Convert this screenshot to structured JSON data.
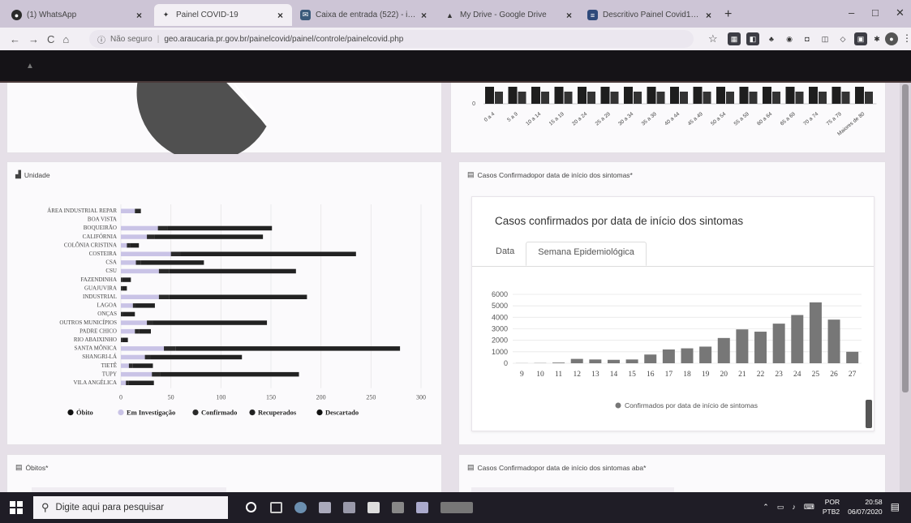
{
  "browser": {
    "tabs": [
      {
        "label": "(1) WhatsApp",
        "icon": "whatsapp-icon"
      },
      {
        "label": "Painel COVID-19",
        "icon": "covid-icon"
      },
      {
        "label": "Caixa de entrada (522) - isaager",
        "icon": "mail-icon"
      },
      {
        "label": "My Drive - Google Drive",
        "icon": "drive-icon"
      },
      {
        "label": "Descritivo Painel Covid19 - Goog",
        "icon": "docs-icon"
      }
    ],
    "new_tab": "+",
    "security": "Não seguro",
    "url": "geo.araucaria.pr.gov.br/painelcovid/painel/controle/painelcovid.php"
  },
  "age_chart": {
    "categories": [
      "0 a 4",
      "5 a 9",
      "10 a 14",
      "15 a 19",
      "20 a 24",
      "25 a 29",
      "30 a 34",
      "35 a 39",
      "40 a 44",
      "45 a 49",
      "50 a 54",
      "55 a 59",
      "60 a 64",
      "65 a 69",
      "70 a 74",
      "75 a 79",
      "Maiores de 80"
    ],
    "zero_label": "0"
  },
  "unidade_card": {
    "title": "Unidade",
    "chart_data": {
      "type": "bar",
      "orientation": "horizontal",
      "stacked": true,
      "categories": [
        "ÁREA INDUSTRIAL REPAR",
        "BOA VISTA",
        "BOQUEIRÃO",
        "CALIFÓRNIA",
        "COLÔNIA CRISTINA",
        "COSTEIRA",
        "CSA",
        "CSU",
        "FAZENDINHA",
        "GUAJUVIRA",
        "INDUSTRIAL",
        "LAGOA",
        "ONÇAS",
        "OUTROS MUNICÍPIOS",
        "PADRE CHICO",
        "RIO ABAIXINHO",
        "SANTA MÔNICA",
        "SHANGRI-LÁ",
        "TIETÊ",
        "TUPY",
        "VILA ANGÉLICA"
      ],
      "series": [
        {
          "name": "Óbito",
          "color": "#111111",
          "values": [
            0,
            0,
            0,
            0,
            0,
            0,
            0,
            0,
            0,
            0,
            0,
            0,
            0,
            0,
            0,
            0,
            0,
            0,
            0,
            0,
            0
          ]
        },
        {
          "name": "Em Investigação",
          "color": "#c9c3e6",
          "values": [
            14,
            0,
            37,
            26,
            6,
            50,
            15,
            38,
            0,
            0,
            38,
            12,
            0,
            26,
            14,
            0,
            43,
            24,
            8,
            31,
            5
          ]
        },
        {
          "name": "Confirmado",
          "color": "#2a2a2a",
          "values": [
            6,
            0,
            10,
            8,
            3,
            10,
            5,
            10,
            1,
            1,
            10,
            3,
            2,
            6,
            4,
            1,
            12,
            6,
            4,
            8,
            3
          ]
        },
        {
          "name": "Recuperados",
          "color": "#222222",
          "values": [
            0,
            0,
            104,
            108,
            9,
            175,
            63,
            127,
            9,
            5,
            138,
            19,
            12,
            114,
            12,
            6,
            224,
            91,
            20,
            139,
            25
          ]
        },
        {
          "name": "Descartado",
          "color": "#111111",
          "values": [
            0,
            0,
            0,
            0,
            0,
            0,
            0,
            0,
            0,
            0,
            0,
            0,
            0,
            0,
            0,
            0,
            0,
            0,
            0,
            0,
            0
          ]
        }
      ],
      "xlim": [
        0,
        300
      ],
      "xticks": [
        0,
        50,
        100,
        150,
        200,
        250,
        300
      ],
      "legend_position": "bottom",
      "grid": true
    }
  },
  "sintomas_card": {
    "title": "Casos Confirmadopor data de início dos sintomas*",
    "panel_title": "Casos confirmados por data de início dos sintomas",
    "tabs": [
      "Data",
      "Semana Epidemiológica"
    ],
    "active_tab": "Semana Epidemiológica",
    "chart_data": {
      "type": "bar",
      "categories": [
        "9",
        "10",
        "11",
        "12",
        "13",
        "14",
        "15",
        "16",
        "17",
        "18",
        "19",
        "20",
        "21",
        "22",
        "23",
        "24",
        "25",
        "26",
        "27"
      ],
      "series": [
        {
          "name": "Confirmados por data de início de sintomas",
          "color": "#777777",
          "values": [
            10,
            20,
            60,
            380,
            330,
            300,
            330,
            760,
            1200,
            1300,
            1450,
            2200,
            2950,
            2750,
            3450,
            4200,
            5300,
            3800,
            1000
          ]
        }
      ],
      "yticks": [
        0,
        1000,
        2000,
        3000,
        4000,
        5000,
        6000
      ],
      "ylim": [
        0,
        6000
      ],
      "legend_position": "bottom",
      "grid": true
    }
  },
  "obitos_card": {
    "title": "Óbitos*"
  },
  "sintomas_aba_card": {
    "title": "Casos Confirmadopor data de início dos sintomas aba*"
  },
  "taskbar": {
    "search_placeholder": "Digite aqui para pesquisar",
    "lang": "POR",
    "layout": "PTB2",
    "time": "20:58",
    "date": "06/07/2020"
  }
}
